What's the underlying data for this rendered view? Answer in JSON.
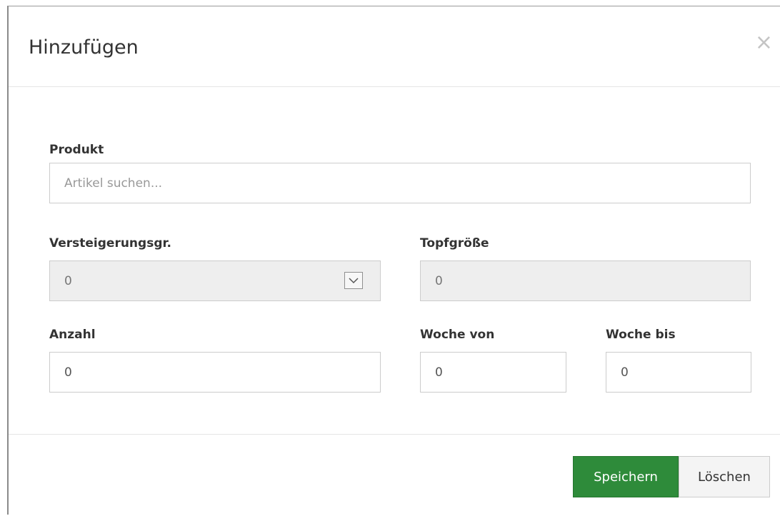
{
  "modal": {
    "title": "Hinzufügen",
    "close_label": "×"
  },
  "form": {
    "produkt": {
      "label": "Produkt",
      "placeholder": "Artikel suchen...",
      "value": ""
    },
    "versteigerungsgr": {
      "label": "Versteigerungsgr.",
      "value": "0"
    },
    "topfgroesse": {
      "label": "Topfgröße",
      "value": "0"
    },
    "anzahl": {
      "label": "Anzahl",
      "value": "0"
    },
    "woche_von": {
      "label": "Woche von",
      "value": "0"
    },
    "woche_bis": {
      "label": "Woche bis",
      "value": "0"
    }
  },
  "footer": {
    "save_label": "Speichern",
    "delete_label": "Löschen"
  },
  "colors": {
    "primary": "#2e8b3a",
    "disabled_bg": "#eeeeee"
  },
  "icons": {
    "close": "close-icon",
    "select_arrow": "chevron-down-icon"
  }
}
